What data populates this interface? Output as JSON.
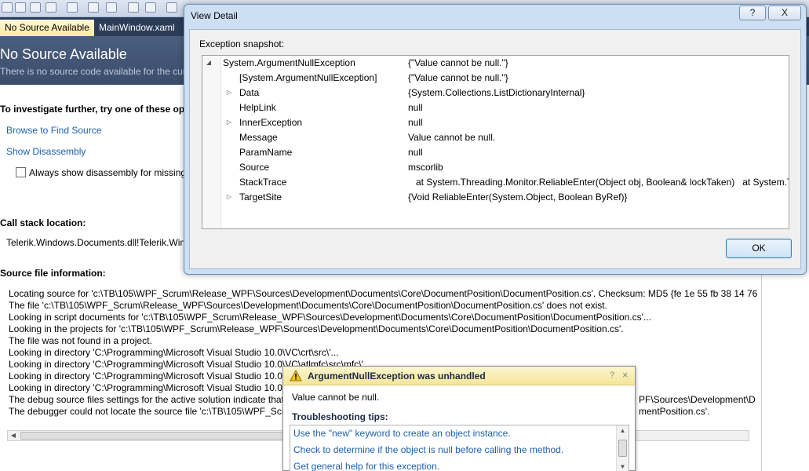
{
  "tabs": [
    {
      "label": "No Source Available"
    },
    {
      "label": "MainWindow.xaml"
    }
  ],
  "no_source": {
    "title": "No Source Available",
    "subtitle": "There is no source code available for the curr",
    "investigate_heading": "To investigate further, try one of these opt",
    "browse_link": "Browse to Find Source",
    "disassembly_link": "Show Disassembly",
    "always_show_label": "Always show disassembly for missing",
    "call_stack_heading": "Call stack location:",
    "call_stack_value": "Telerik.Windows.Documents.dll!Telerik.Win",
    "source_file_heading": "Source file information:",
    "log_lines": [
      "Locating source for 'c:\\TB\\105\\WPF_Scrum\\Release_WPF\\Sources\\Development\\Documents\\Core\\DocumentPosition\\DocumentPosition.cs'. Checksum: MD5 {fe 1e 55 fb 38 14 76",
      "The file 'c:\\TB\\105\\WPF_Scrum\\Release_WPF\\Sources\\Development\\Documents\\Core\\DocumentPosition\\DocumentPosition.cs' does not exist.",
      "Looking in script documents for 'c:\\TB\\105\\WPF_Scrum\\Release_WPF\\Sources\\Development\\Documents\\Core\\DocumentPosition\\DocumentPosition.cs'...",
      "Looking in the projects for 'c:\\TB\\105\\WPF_Scrum\\Release_WPF\\Sources\\Development\\Documents\\Core\\DocumentPosition\\DocumentPosition.cs'.",
      "The file was not found in a project.",
      "Looking in directory 'C:\\Programming\\Microsoft Visual Studio 10.0\\VC\\crt\\src\\'...",
      "Looking in directory 'C:\\Programming\\Microsoft Visual Studio 10.0\\VC\\atlmfc\\src\\mfc\\'...",
      "Looking in directory 'C:\\Programming\\Microsoft Visual Studio 10.0",
      "Looking in directory 'C:\\Programming\\Microsoft Visual Studio 10.0",
      "The debug source files settings for the active solution indicate that",
      "The debugger could not locate the source file 'c:\\TB\\105\\WPF_Scr"
    ],
    "log_tail_1": "PF\\Sources\\Development\\D",
    "log_tail_2": "mentPosition.cs'."
  },
  "view_detail": {
    "title": "View Detail",
    "help_label": "?",
    "close_label": "X",
    "snapshot_label": "Exception snapshot:",
    "ok_label": "OK",
    "rows": [
      {
        "name": "System.ArgumentNullException",
        "value": "{\"Value cannot be null.\"}"
      },
      {
        "name": "[System.ArgumentNullException]",
        "value": "{\"Value cannot be null.\"}"
      },
      {
        "name": "Data",
        "value": "{System.Collections.ListDictionaryInternal}"
      },
      {
        "name": "HelpLink",
        "value": "null"
      },
      {
        "name": "InnerException",
        "value": "null"
      },
      {
        "name": "Message",
        "value": "Value cannot be null."
      },
      {
        "name": "ParamName",
        "value": "null"
      },
      {
        "name": "Source",
        "value": "mscorlib"
      },
      {
        "name": "StackTrace",
        "value": "   at System.Threading.Monitor.ReliableEnter(Object obj, Boolean& lockTaken)   at System.Th"
      },
      {
        "name": "TargetSite",
        "value": "{Void ReliableEnter(System.Object, Boolean ByRef)}"
      }
    ]
  },
  "exception_helper": {
    "title": "ArgumentNullException was unhandled",
    "help_label": "?",
    "close_label": "×",
    "message": "Value cannot be null.",
    "tips_heading": "Troubleshooting tips:",
    "tips": [
      "Use the \"new\" keyword to create an object instance.",
      "Check to determine if the object is null before calling the method.",
      "Get general help for this exception."
    ]
  }
}
